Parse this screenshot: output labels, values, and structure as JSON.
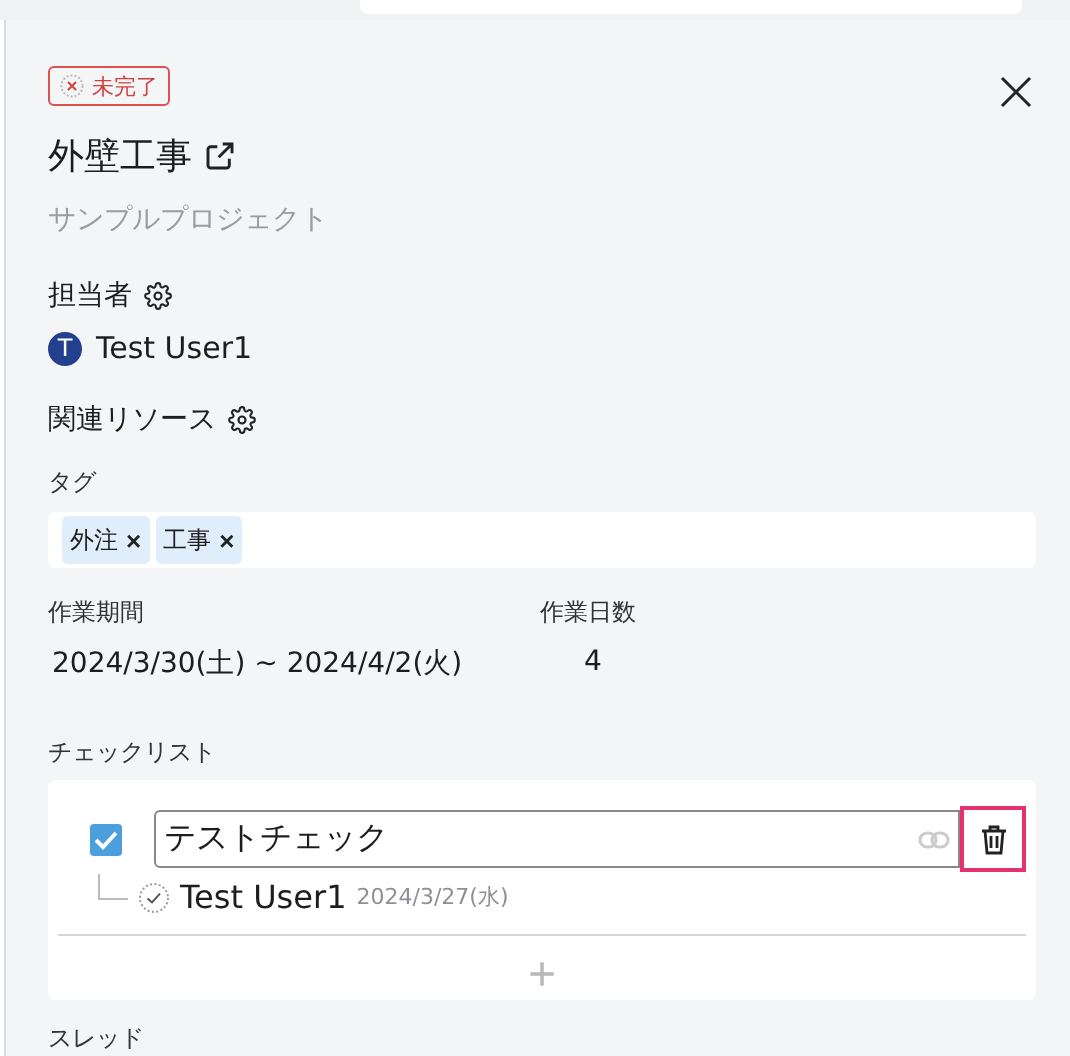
{
  "status": {
    "label": "未完了",
    "done": false
  },
  "title": "外壁工事",
  "project": "サンプルプロジェクト",
  "assignee": {
    "label": "担当者",
    "user": {
      "initial": "T",
      "name": "Test User1"
    }
  },
  "resources": {
    "label": "関連リソース"
  },
  "tags": {
    "label": "タグ",
    "items": [
      "外注",
      "工事"
    ],
    "remove": "×"
  },
  "period": {
    "label": "作業期間",
    "value": "2024/3/30(土) ~ 2024/4/2(火)"
  },
  "days": {
    "label": "作業日数",
    "value": "4"
  },
  "checklist": {
    "label": "チェックリスト",
    "items": [
      {
        "text": "テストチェック",
        "checked": true,
        "highlighted": true,
        "checked_by": "Test User1",
        "checked_at": "2024/3/27(水)"
      }
    ],
    "add": "+"
  },
  "thread": {
    "label": "スレッド"
  }
}
